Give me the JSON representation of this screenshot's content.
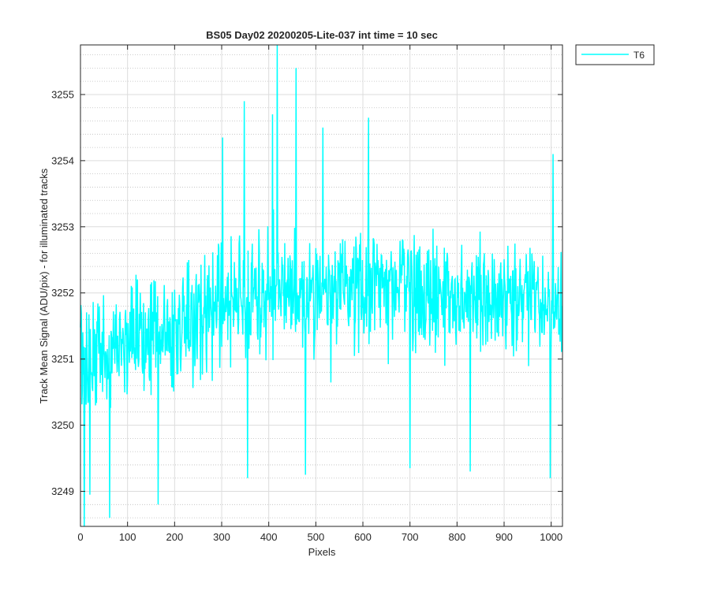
{
  "chart_data": {
    "type": "line",
    "title": "BS05 Day02 20200205-Lite-037 int time = 10 sec",
    "xlabel": "Pixels",
    "ylabel": "Track Mean Signal (ADU/pix) - for illuminated tracks",
    "xlim": [
      0,
      1024
    ],
    "ylim": [
      3248.47,
      3255.75
    ],
    "xticks": [
      0,
      100,
      200,
      300,
      400,
      500,
      600,
      700,
      800,
      900,
      1000
    ],
    "xtick_labels": [
      "0",
      "100",
      "200",
      "300",
      "400",
      "500",
      "600",
      "700",
      "800",
      "900",
      "1000"
    ],
    "yticks": [
      3249,
      3250,
      3251,
      3252,
      3253,
      3254,
      3255
    ],
    "ytick_labels": [
      "3249",
      "3250",
      "3251",
      "3252",
      "3253",
      "3254",
      "3255"
    ],
    "grid": true,
    "minor_grid": true,
    "legend_location": "outside top-right",
    "series": [
      {
        "name": "T6",
        "color": "#00FFFF",
        "baseline_profile": {
          "x": [
            0,
            50,
            100,
            150,
            200,
            250,
            300,
            350,
            400,
            450,
            500,
            550,
            600,
            650,
            700,
            750,
            800,
            850,
            900,
            950,
            1000,
            1024
          ],
          "y": [
            3251.0,
            3251.0,
            3251.2,
            3251.4,
            3251.5,
            3251.6,
            3251.8,
            3251.9,
            3252.0,
            3252.0,
            3252.0,
            3252.0,
            3252.1,
            3252.1,
            3252.1,
            3252.0,
            3251.9,
            3251.9,
            3251.9,
            3251.8,
            3251.7,
            3251.7
          ]
        },
        "notable_points": [
          {
            "x": 418,
            "y": 3255.75
          },
          {
            "x": 458,
            "y": 3255.4
          },
          {
            "x": 348,
            "y": 3254.9
          },
          {
            "x": 408,
            "y": 3254.7
          },
          {
            "x": 612,
            "y": 3254.65
          },
          {
            "x": 515,
            "y": 3254.5
          },
          {
            "x": 302,
            "y": 3254.35
          },
          {
            "x": 1004,
            "y": 3254.1
          },
          {
            "x": 8,
            "y": 3248.47
          },
          {
            "x": 62,
            "y": 3248.6
          },
          {
            "x": 165,
            "y": 3248.8
          },
          {
            "x": 20,
            "y": 3248.95
          },
          {
            "x": 355,
            "y": 3249.2
          },
          {
            "x": 478,
            "y": 3249.25
          },
          {
            "x": 700,
            "y": 3249.35
          },
          {
            "x": 828,
            "y": 3249.3
          },
          {
            "x": 998,
            "y": 3249.2
          }
        ],
        "n_points": 1024
      }
    ]
  }
}
